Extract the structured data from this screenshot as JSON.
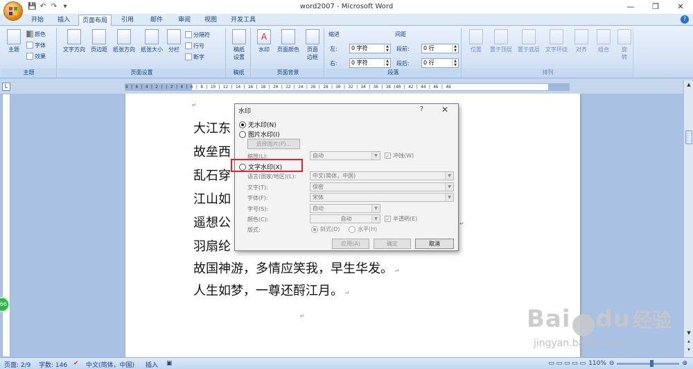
{
  "app": {
    "title": "word2007 - Microsoft Word",
    "window_controls": [
      "—",
      "❐",
      "✕"
    ]
  },
  "qat": [
    "💾",
    "↶",
    "↷",
    "▾"
  ],
  "tabs": [
    "开始",
    "插入",
    "页面布局",
    "引用",
    "邮件",
    "审阅",
    "视图",
    "开发工具"
  ],
  "active_tab": "页面布局",
  "ribbon": {
    "groups": {
      "theme": "主题",
      "page_setup": "页面设置",
      "draft": "稿纸",
      "page_bg": "页面背景",
      "paragraph": "段落",
      "arrange": "排列"
    },
    "theme": {
      "main": "主题",
      "colors": "颜色",
      "fonts": "字体",
      "effects": "效果"
    },
    "page_setup": {
      "text_dir": "文字方向",
      "margins": "页边距",
      "orientation": "纸张方向",
      "size": "纸张大小",
      "columns": "分栏",
      "breaks": "分隔符",
      "line_numbers": "行号",
      "hyphenation": "断字"
    },
    "draft": {
      "label": "稿纸\n设置"
    },
    "page_bg": {
      "watermark": "水印",
      "page_color": "页面颜色",
      "page_border": "页面\n边框"
    },
    "paragraph": {
      "indent": "缩进",
      "spacing": "间距",
      "left_label": "左:",
      "right_label": "右:",
      "before_label": "段前:",
      "after_label": "段后:",
      "left_val": "0 字符",
      "right_val": "0 字符",
      "before_val": "0 行",
      "after_val": "0 行"
    },
    "arrange": {
      "position": "位置",
      "bring_front": "置于顶层",
      "send_back": "置于底层",
      "text_wrap": "文字环绕",
      "align": "对齐",
      "group": "组合",
      "rotate": "旋\n转"
    }
  },
  "ruler": {
    "h_ticks": "8 | 6 | 4 | 2 |   | 2 | 4 | 6 | 8 | 10 | 12 | 14 | 16 | 18 | 20 | 22 | 24 | 26 | 28 | 30 | 32 | 34 | 36 | 38 |40 | 42 | 44 | 46 | 48"
  },
  "document": {
    "lines": [
      "大江东",
      "故垒西",
      "乱石穿",
      "江山如",
      "遥想公",
      "羽扇纶",
      "故国神游，多情应笑我，早生华发。",
      "人生如梦，一尊还酹江月。"
    ]
  },
  "dialog": {
    "title": "水印",
    "help": "?",
    "close": "✕",
    "no_watermark": "无水印(N)",
    "picture_watermark": "图片水印(I)",
    "select_picture": "选择图片(P)...",
    "scale_label": "缩放(L):",
    "scale_value": "自动",
    "washout": "冲蚀(W)",
    "text_watermark": "文字水印(X)",
    "language_label": "语言(国家/地区)(L):",
    "language_value": "中文(简体，中国)",
    "text_label": "文字(T):",
    "text_value": "保密",
    "font_label": "字体(F):",
    "font_value": "宋体",
    "size_label": "字号(S):",
    "size_value": "自动",
    "color_label": "颜色(C):",
    "color_value": "自动",
    "semitransparent": "半透明(E)",
    "layout_label": "版式:",
    "diagonal": "斜式(D)",
    "horizontal": "水平(H)",
    "apply": "应用(A)",
    "ok": "确定",
    "cancel": "取消"
  },
  "status": {
    "page": "页面: 2/9",
    "words": "字数: 146",
    "language": "中文(简体，中国)",
    "insert": "插入",
    "zoom": "110%"
  },
  "side_badge": "66",
  "watermark_brand": {
    "text1": "Bai",
    "text2": "du",
    "cn": "经验",
    "url": "jingyan.baidu.com"
  },
  "colors": {
    "accent": "#15428b",
    "highlight": "#e8202a",
    "ribbon_bg": "#d5e3f5",
    "doc_bg": "#a9c1e2"
  }
}
